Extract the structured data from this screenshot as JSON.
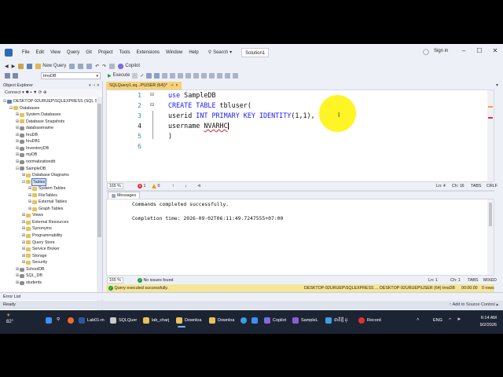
{
  "menu": {
    "items": [
      "File",
      "Edit",
      "View",
      "Query",
      "Git",
      "Project",
      "Tools",
      "Extensions",
      "Window",
      "Help"
    ],
    "search_label": "Search",
    "solution_label": "Solution1",
    "signin_label": "Sign in"
  },
  "toolbar": {
    "new_query_label": "New Query",
    "copilot_label": "Copilot",
    "database": "tmsDB",
    "execute_label": "Execute"
  },
  "object_explorer": {
    "title": "Object Explorer",
    "connect_label": "Connect",
    "tree": [
      {
        "label": "DESKTOP-92URUEP\\SQLEXPRESS (SQL Se",
        "level": 0,
        "exp": "−",
        "icon": "server"
      },
      {
        "label": "Databases",
        "level": 1,
        "exp": "−",
        "icon": "folder"
      },
      {
        "label": "System Databases",
        "level": 2,
        "exp": "+",
        "icon": "folder"
      },
      {
        "label": "Database Snapshots",
        "level": 2,
        "exp": "+",
        "icon": "folder"
      },
      {
        "label": "databasename",
        "level": 2,
        "exp": "+",
        "icon": "db"
      },
      {
        "label": "hruDB",
        "level": 2,
        "exp": "+",
        "icon": "db"
      },
      {
        "label": "hruDB1",
        "level": 2,
        "exp": "+",
        "icon": "db"
      },
      {
        "label": "InventoryDB",
        "level": 2,
        "exp": "+",
        "icon": "db"
      },
      {
        "label": "myDB",
        "level": 2,
        "exp": "+",
        "icon": "db"
      },
      {
        "label": "normalizationdb",
        "level": 2,
        "exp": "+",
        "icon": "db"
      },
      {
        "label": "SampleDB",
        "level": 2,
        "exp": "−",
        "icon": "db"
      },
      {
        "label": "Database Diagrams",
        "level": 3,
        "exp": "+",
        "icon": "folder"
      },
      {
        "label": "Tables",
        "level": 3,
        "exp": "−",
        "icon": "folder",
        "selected": true
      },
      {
        "label": "System Tables",
        "level": 4,
        "exp": "+",
        "icon": "folder"
      },
      {
        "label": "FileTables",
        "level": 4,
        "exp": "+",
        "icon": "folder"
      },
      {
        "label": "External Tables",
        "level": 4,
        "exp": "+",
        "icon": "folder"
      },
      {
        "label": "Graph Tables",
        "level": 4,
        "exp": "+",
        "icon": "folder"
      },
      {
        "label": "Views",
        "level": 3,
        "exp": "+",
        "icon": "folder"
      },
      {
        "label": "External Resources",
        "level": 3,
        "exp": "+",
        "icon": "folder"
      },
      {
        "label": "Synonyms",
        "level": 3,
        "exp": "+",
        "icon": "folder"
      },
      {
        "label": "Programmability",
        "level": 3,
        "exp": "+",
        "icon": "folder"
      },
      {
        "label": "Query Store",
        "level": 3,
        "exp": "+",
        "icon": "folder"
      },
      {
        "label": "Service Broker",
        "level": 3,
        "exp": "+",
        "icon": "folder"
      },
      {
        "label": "Storage",
        "level": 3,
        "exp": "+",
        "icon": "folder"
      },
      {
        "label": "Security",
        "level": 3,
        "exp": "+",
        "icon": "folder"
      },
      {
        "label": "SchoolDB",
        "level": 2,
        "exp": "+",
        "icon": "db"
      },
      {
        "label": "SQL_DB",
        "level": 2,
        "exp": "+",
        "icon": "db"
      },
      {
        "label": "students",
        "level": 2,
        "exp": "+",
        "icon": "db"
      }
    ]
  },
  "doc_tab": {
    "label": "SQLQuery1.sq...P\\USER (64))*",
    "pin": "⊣",
    "close": "×"
  },
  "editor": {
    "line_numbers": [
      "1",
      "2",
      "3",
      "4",
      "5",
      "6"
    ],
    "zoom": "165 %",
    "errors": "1",
    "warnings": "0",
    "ln": "Ln: 4",
    "ch": "Ch: 16",
    "tabs": "TABS",
    "crlf": "CRLF"
  },
  "results": {
    "messages_tab": "Messages",
    "line1": "Commands completed successfully.",
    "line2": "Completion time: 2026-09-02T06:11:49.7247555+07:00",
    "zoom": "165 %",
    "no_issues": "No issues found",
    "ln": "Ln: 1",
    "ch": "Ch: 1",
    "tabs": "TABS",
    "mixed": "MIXED"
  },
  "query_status": {
    "message": "Query executed successfully.",
    "server": "DESKTOP-92URUEP\\SQLEXPRESS ...",
    "user": "DESKTOP-92URUEP\\USER (64)",
    "db": "tmsDB",
    "time": "00:00:00",
    "rows": "0 rows"
  },
  "bottom": {
    "error_list": "Error List",
    "ready": "Ready",
    "add_source": "↑ Add to Source Control ▴"
  },
  "taskbar": {
    "temp": "82°",
    "apps": [
      "Lab01-m",
      "SQLQuer",
      "lab_charj",
      "Downloa",
      "Downloa",
      "Copilot",
      "SampleL",
      "ជាតិថ្មី ដ្",
      "Record"
    ],
    "lang": "ENG",
    "time": "6:14 AM",
    "date": "9/2/2026"
  },
  "colors": {
    "accent": "#2d6ab3",
    "keyword": "#1a1aff",
    "line_number": "#2b91af",
    "status_yellow": "#f5e59a",
    "highlight": "#fff200"
  }
}
